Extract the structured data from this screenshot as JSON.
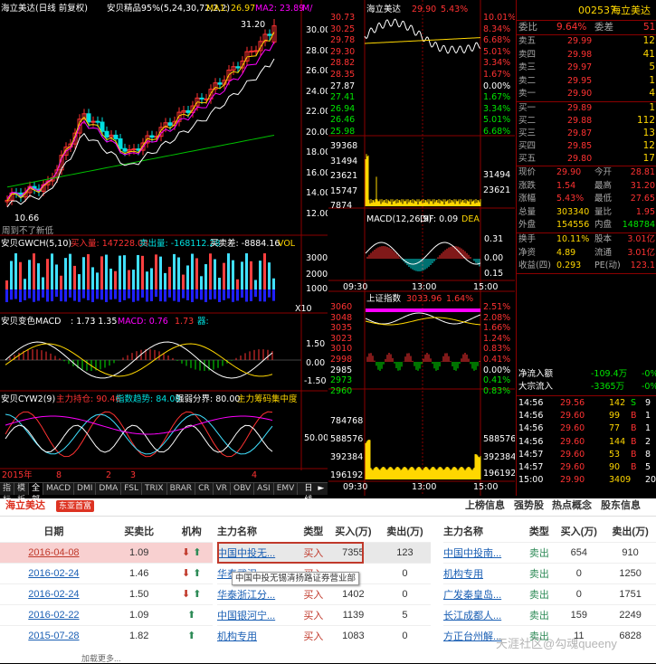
{
  "kline": {
    "title": "海立美达(日线 前复权)",
    "ind": "安贝精品95%(5,24,30,72,2,2)",
    "ma1": "MA1: 26.97",
    "ma2": "MA2: 23.89",
    "ma3": "M/",
    "high_label": "31.20",
    "low_label": "10.66",
    "note": "周到不了新低",
    "y": [
      "30.00",
      "28.00",
      "26.00",
      "24.00",
      "22.00",
      "20.00",
      "18.00",
      "16.00",
      "14.00",
      "12.00"
    ]
  },
  "gwch": {
    "title": "安贝GWCH(5,10)",
    "buy": "买入量: 147228.08",
    "sell": "卖出量: -168112.28",
    "net": "买卖差: -8884.16",
    "vol": "VOL",
    "y": [
      "30000",
      "20000",
      "10000",
      "X10"
    ]
  },
  "macd": {
    "title": "安贝变色MACD",
    "v1": ": 1.73",
    "v2": ": 1.35",
    "v3": "MACD: 0.76",
    "v4": "1.73",
    "v5": "器:",
    "y": [
      "1.50",
      "0.00",
      "-1.50"
    ]
  },
  "cyw": {
    "title": "安贝CYW2(9)",
    "f1": "主力持仓: 90.46",
    "f2": "指数趋势: 84.08",
    "f3": "强弱分界: 80.00",
    "f4": "主力筹码集中度",
    "y": [
      "50.00"
    ]
  },
  "axis": {
    "year": "2015年",
    "m1": "8",
    "m2": "2",
    "m3": "3",
    "m4": "4"
  },
  "tabs": [
    "指标",
    "模板",
    "全部",
    "MACD",
    "DMI",
    "DMA",
    "FSL",
    "TRIX",
    "BRAR",
    "CR",
    "VR",
    "OBV",
    "ASI",
    "EMV"
  ],
  "tab_extra": [
    "日线",
    "►",
    "≡"
  ],
  "intraday": {
    "title": "海立美达",
    "price": "29.90",
    "pct": "5.43%",
    "left": [
      "30.73",
      "30.25",
      "29.78",
      "29.30",
      "28.82",
      "28.35",
      "27.87",
      "27.41",
      "26.94",
      "26.46",
      "25.98"
    ],
    "right": [
      "10.01%",
      "8.34%",
      "6.68%",
      "5.01%",
      "3.34%",
      "1.67%",
      "0.00%",
      "1.67%",
      "3.34%",
      "5.01%",
      "6.68%"
    ],
    "vol": [
      "39368",
      "31494",
      "23621",
      "15747",
      "7874"
    ],
    "macd": "MACD(12,26,9)",
    "dif": "DIF: 0.09",
    "dea": "DEA",
    "m_y": [
      "0.31",
      "0.00",
      "0.15"
    ],
    "t1": "09:30",
    "t2": "13:00",
    "t3": "15:00"
  },
  "index": {
    "title": "上证指数",
    "val": "3033.96",
    "pct": "1.64%",
    "left": [
      "3060",
      "3048",
      "3035",
      "3023",
      "3010",
      "2998",
      "2985",
      "2973",
      "2960"
    ],
    "right": [
      "2.51%",
      "2.08%",
      "1.66%",
      "1.24%",
      "0.83%",
      "0.41%",
      "0.00%",
      "0.41%",
      "0.83%"
    ],
    "vol": [
      "784768",
      "588576",
      "392384",
      "196192"
    ],
    "t1": "09:30",
    "t2": "13:00",
    "t3": "15:00"
  },
  "orderbook": {
    "code": "002537",
    "name": "海立美达",
    "wb_label": "委比",
    "wb": "9.64%",
    "wc_label": "委差",
    "wc": "51",
    "asks": [
      [
        "卖五",
        "29.99",
        "12"
      ],
      [
        "卖四",
        "29.98",
        "41"
      ],
      [
        "卖三",
        "29.97",
        "5"
      ],
      [
        "卖二",
        "29.95",
        "1"
      ],
      [
        "卖一",
        "29.90",
        "4"
      ]
    ],
    "bids": [
      [
        "买一",
        "29.89",
        "1"
      ],
      [
        "买二",
        "29.88",
        "112"
      ],
      [
        "买三",
        "29.87",
        "13"
      ],
      [
        "买四",
        "29.85",
        "12"
      ],
      [
        "买五",
        "29.80",
        "17"
      ]
    ],
    "stats": [
      [
        "现价",
        "29.90",
        "今开",
        "28.81"
      ],
      [
        "涨跌",
        "1.54",
        "最高",
        "31.20"
      ],
      [
        "涨幅",
        "5.43%",
        "最低",
        "27.65"
      ],
      [
        "总量",
        "303340",
        "量比",
        "1.95"
      ],
      [
        "外盘",
        "154556",
        "内盘",
        "148784"
      ]
    ],
    "stats2": [
      [
        "换手",
        "10.11%",
        "股本",
        "3.01亿"
      ],
      [
        "净资",
        "4.89",
        "流通",
        "3.01亿"
      ],
      [
        "收益(四)",
        "0.293",
        "PE(动)",
        "123.1"
      ]
    ],
    "flow": [
      [
        "净流入额",
        "-109.4万",
        "-0%"
      ],
      [
        "大宗流入",
        "-3365万",
        "-0%"
      ]
    ],
    "ticks": [
      [
        "14:56",
        "29.56",
        "142",
        "S",
        "9"
      ],
      [
        "14:56",
        "29.60",
        "99",
        "B",
        "1"
      ],
      [
        "14:56",
        "29.60",
        "77",
        "B",
        "1"
      ],
      [
        "14:56",
        "29.60",
        "144",
        "B",
        "2"
      ],
      [
        "14:57",
        "29.60",
        "53",
        "B",
        "8"
      ],
      [
        "14:57",
        "29.60",
        "90",
        "B",
        "5"
      ],
      [
        "15:00",
        "29.90",
        "3409",
        "",
        "202"
      ]
    ]
  },
  "bottom": {
    "stock": "海立美达",
    "tag": "东亚首富",
    "links": [
      "上榜信息",
      "强势股",
      "热点概念",
      "股东信息"
    ],
    "lh": [
      "日期",
      "买卖比",
      "机构"
    ],
    "rows": [
      [
        "2016-04-08",
        "1.09"
      ],
      [
        "2016-02-24",
        "1.46"
      ],
      [
        "2016-02-24",
        "1.50"
      ],
      [
        "2016-02-22",
        "1.09"
      ],
      [
        "2015-07-28",
        "1.82"
      ]
    ],
    "more": "加载更多...",
    "mh": [
      "主力名称",
      "类型",
      "买入(万)",
      "卖出(万)"
    ],
    "mrows": [
      [
        "中国中投无...",
        "买入",
        "7355",
        "123"
      ],
      [
        "华泰武汉",
        "买入",
        "",
        "0"
      ],
      [
        "华泰浙江分...",
        "买入",
        "1402",
        "0"
      ],
      [
        "中国银河宁...",
        "买入",
        "1139",
        "5"
      ],
      [
        "机构专用",
        "买入",
        "1083",
        "0"
      ]
    ],
    "tooltip": "中国中投无锡清扬路证券营业部",
    "rh": [
      "主力名称",
      "类型",
      "买入(万)",
      "卖出(万)"
    ],
    "rrows": [
      [
        "中国中投南...",
        "卖出",
        "654",
        "910"
      ],
      [
        "机构专用",
        "卖出",
        "0",
        "1250"
      ],
      [
        "广发秦皇岛...",
        "卖出",
        "0",
        "1751"
      ],
      [
        "长江成都人...",
        "卖出",
        "159",
        "2249"
      ],
      [
        "方正台州解...",
        "卖出",
        "11",
        "6828"
      ]
    ],
    "watermark": "天涯社区@勾魂queeny"
  }
}
